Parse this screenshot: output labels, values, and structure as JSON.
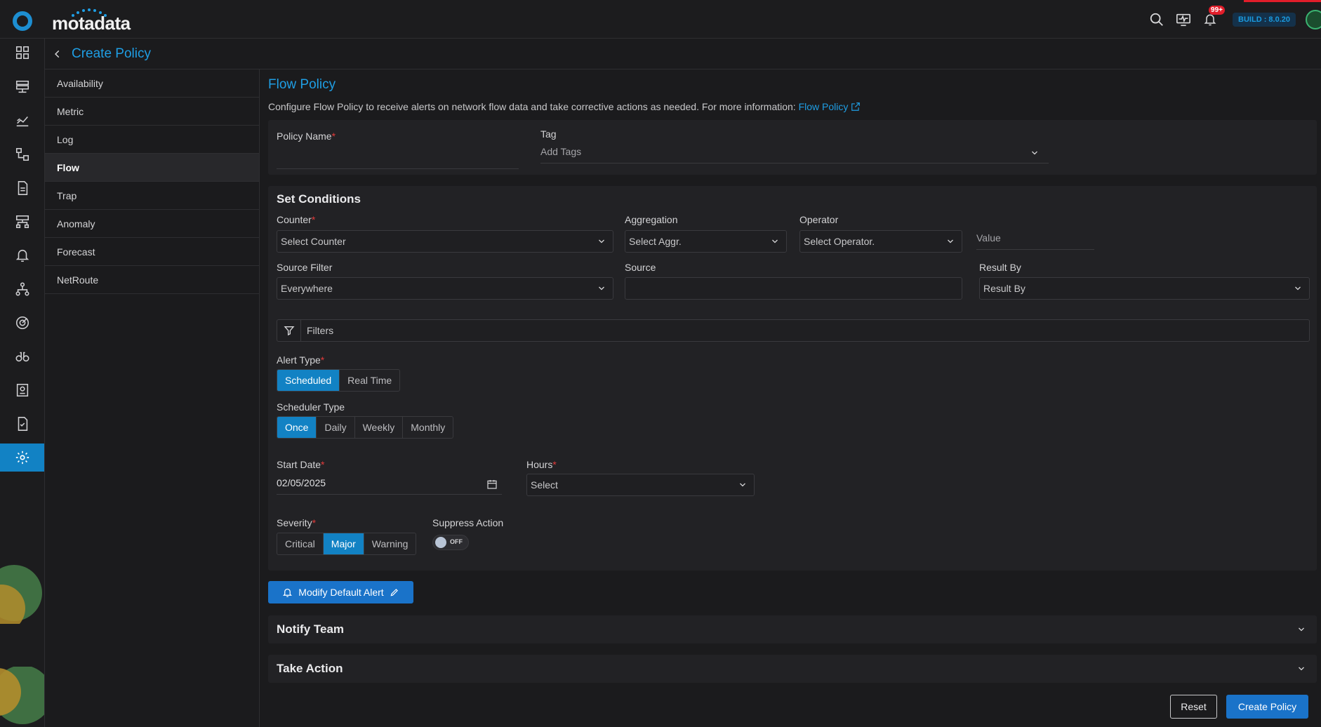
{
  "app": {
    "logo_text": "motadata",
    "notification_count": "99+",
    "build": "BUILD : 8.0.20"
  },
  "header": {
    "title": "Create Policy"
  },
  "subnav": {
    "items": [
      "Availability",
      "Metric",
      "Log",
      "Flow",
      "Trap",
      "Anomaly",
      "Forecast",
      "NetRoute"
    ],
    "active": "Flow"
  },
  "main": {
    "title": "Flow Policy",
    "description": "Configure Flow Policy to receive alerts on network flow data and take corrective actions as needed. For more information:",
    "link_text": "Flow Policy",
    "policy_name_label": "Policy Name",
    "tag_label": "Tag",
    "tag_placeholder": "Add Tags",
    "conditions": {
      "title": "Set Conditions",
      "counter_label": "Counter",
      "counter_value": "Select Counter",
      "aggregation_label": "Aggregation",
      "aggregation_value": "Select Aggr.",
      "operator_label": "Operator",
      "operator_value": "Select Operator.",
      "value_placeholder": "Value",
      "source_filter_label": "Source Filter",
      "source_filter_value": "Everywhere",
      "source_label": "Source",
      "result_by_label": "Result By",
      "result_by_value": "Result By",
      "filters_label": "Filters",
      "alert_type_label": "Alert Type",
      "alert_types": [
        "Scheduled",
        "Real Time"
      ],
      "alert_type_selected": "Scheduled",
      "scheduler_type_label": "Scheduler Type",
      "scheduler_types": [
        "Once",
        "Daily",
        "Weekly",
        "Monthly"
      ],
      "scheduler_type_selected": "Once",
      "start_date_label": "Start Date",
      "start_date_value": "02/05/2025",
      "hours_label": "Hours",
      "hours_value": "Select",
      "severity_label": "Severity",
      "severities": [
        "Critical",
        "Major",
        "Warning"
      ],
      "severity_selected": "Major",
      "suppress_label": "Suppress Action",
      "suppress_state": "OFF"
    },
    "modify_alert_label": "Modify Default Alert",
    "notify_team_title": "Notify Team",
    "take_action_title": "Take Action",
    "reset_label": "Reset",
    "create_label": "Create Policy"
  },
  "colors": {
    "accent": "#1f9ee4",
    "primary_button": "#1a73c9",
    "selected": "#1282c4",
    "required": "#e23b3b"
  }
}
